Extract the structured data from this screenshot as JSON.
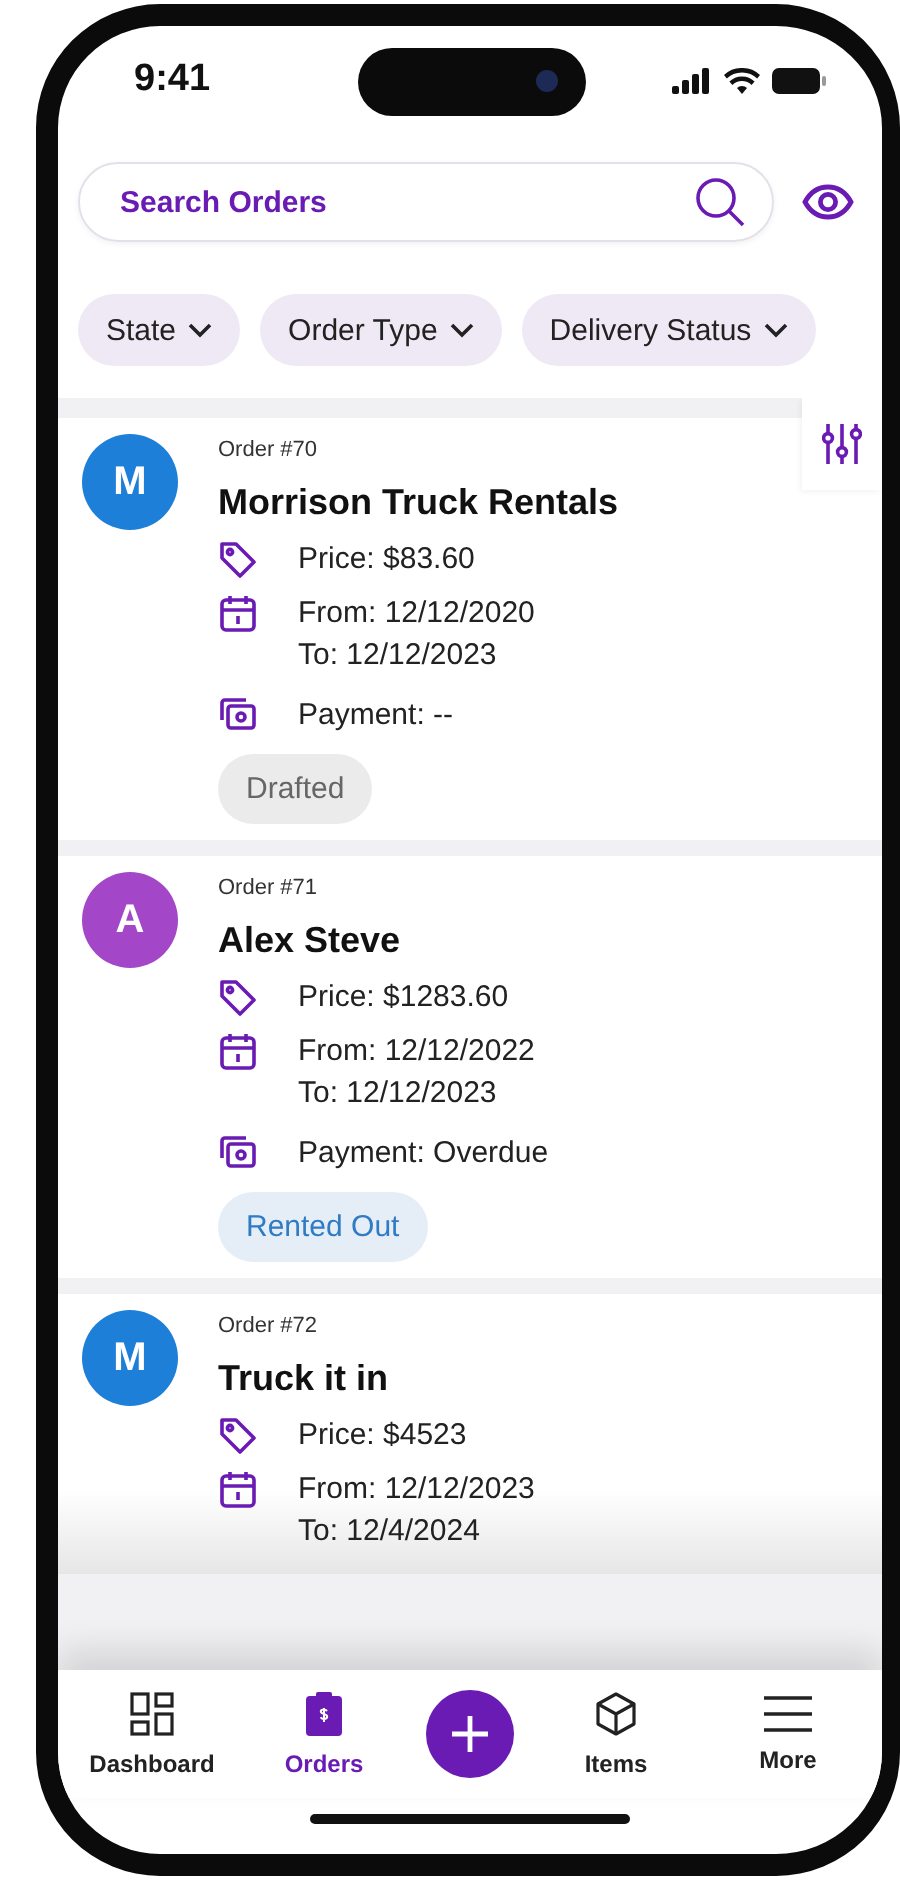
{
  "status_bar": {
    "time": "9:41"
  },
  "search": {
    "placeholder": "Search Orders"
  },
  "filters": [
    {
      "label": "State"
    },
    {
      "label": "Order Type"
    },
    {
      "label": "Delivery Status"
    }
  ],
  "orders": [
    {
      "initial": "M",
      "color": "#1e7fd8",
      "number": "Order #70",
      "name": "Morrison Truck Rentals",
      "price": "Price: $83.60",
      "from": "From: 12/12/2020",
      "to": "To: 12/12/2023",
      "payment": "Payment: --",
      "status": {
        "label": "Drafted",
        "kind": "drafted"
      }
    },
    {
      "initial": "A",
      "color": "#a347c8",
      "number": "Order #71",
      "name": "Alex Steve",
      "price": "Price: $1283.60",
      "from": "From: 12/12/2022",
      "to": "To: 12/12/2023",
      "payment": "Payment: Overdue",
      "status": {
        "label": "Rented Out",
        "kind": "rented"
      }
    },
    {
      "initial": "M",
      "color": "#1e7fd8",
      "number": "Order #72",
      "name": "Truck it in",
      "price": "Price: $4523",
      "from": "From: 12/12/2023",
      "to": "To: 12/4/2024"
    }
  ],
  "nav": [
    {
      "kind": "tab",
      "label": "Dashboard",
      "selected": false
    },
    {
      "kind": "tab",
      "label": "Orders",
      "selected": true
    },
    {
      "kind": "fab"
    },
    {
      "kind": "tab",
      "label": "Items",
      "selected": false
    },
    {
      "kind": "tab",
      "label": "More",
      "selected": false
    }
  ]
}
